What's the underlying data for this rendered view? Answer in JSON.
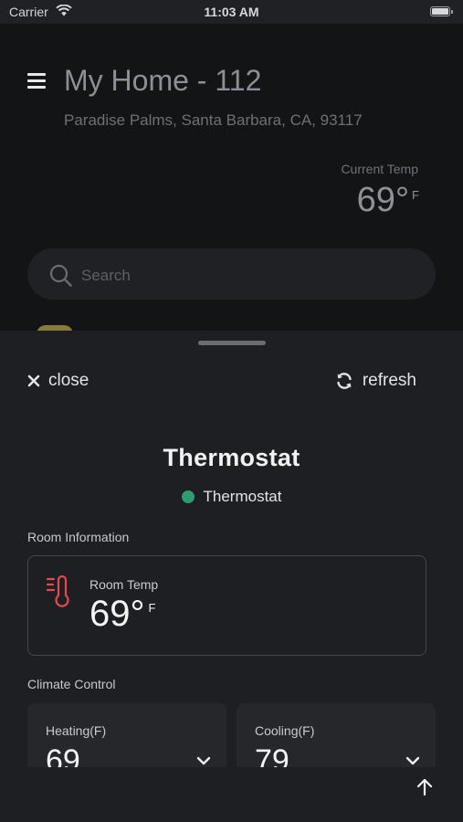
{
  "status_bar": {
    "carrier": "Carrier",
    "time": "11:03 AM"
  },
  "background": {
    "title": "My Home - 112",
    "address": "Paradise Palms, Santa Barbara, CA, 93117",
    "current_temp_label": "Current Temp",
    "current_temp_value": "69°",
    "current_temp_unit": "F",
    "search_placeholder": "Search"
  },
  "sheet": {
    "close_label": "close",
    "refresh_label": "refresh",
    "title": "Thermostat",
    "status_text": "Thermostat",
    "status_color": "#2f9a73",
    "room_section_label": "Room Information",
    "room_temp_label": "Room Temp",
    "room_temp_value": "69°",
    "room_temp_unit": "F",
    "climate_section_label": "Climate Control",
    "heating_label": "Heating(F)",
    "heating_value": "69",
    "cooling_label": "Cooling(F)",
    "cooling_value": "79"
  },
  "icons": [
    "wifi-icon",
    "battery-icon",
    "menu-icon",
    "search-icon",
    "close-icon",
    "refresh-icon",
    "thermometer-icon",
    "chevron-down-icon",
    "arrow-up-icon"
  ],
  "colors": {
    "accent_alert": "#e5484d",
    "status_online": "#2f9a73"
  }
}
